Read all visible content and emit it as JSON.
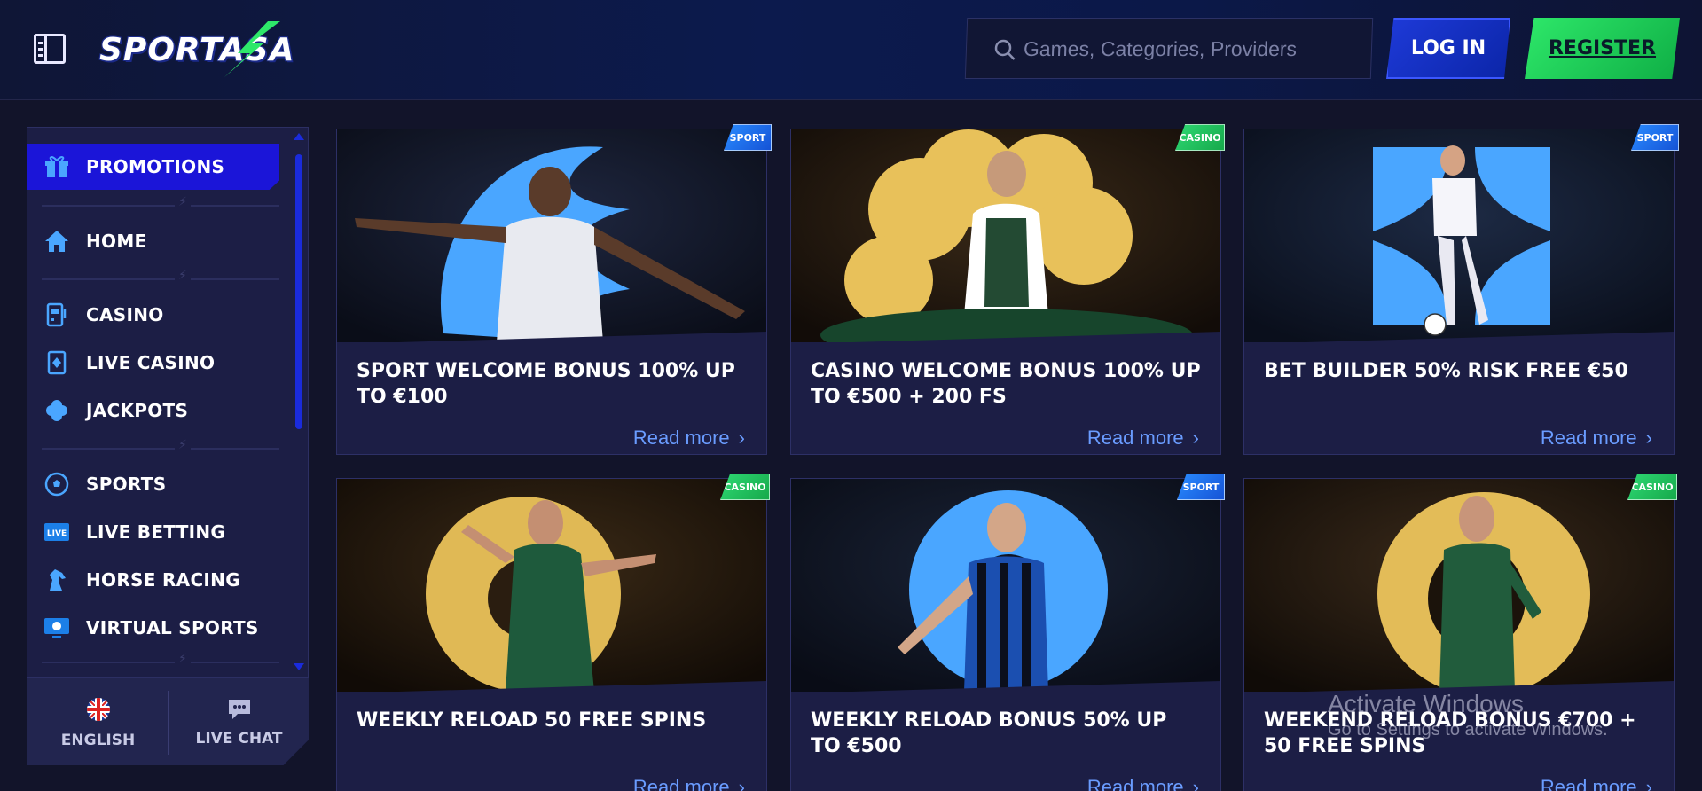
{
  "header": {
    "logo_text": "SPORTASA",
    "search_placeholder": "Games, Categories, Providers",
    "login_label": "LOG IN",
    "register_label": "REGISTER"
  },
  "sidebar": {
    "items": [
      {
        "label": "PROMOTIONS",
        "icon": "gift-icon",
        "active": true
      },
      {
        "label": "HOME",
        "icon": "home-icon"
      },
      {
        "label": "CASINO",
        "icon": "slot-machine-icon"
      },
      {
        "label": "LIVE CASINO",
        "icon": "card-diamond-icon"
      },
      {
        "label": "JACKPOTS",
        "icon": "clover-icon"
      },
      {
        "label": "SPORTS",
        "icon": "soccer-ball-icon"
      },
      {
        "label": "LIVE BETTING",
        "icon": "live-icon"
      },
      {
        "label": "HORSE RACING",
        "icon": "horse-icon"
      },
      {
        "label": "VIRTUAL SPORTS",
        "icon": "monitor-icon"
      }
    ],
    "language_label": "ENGLISH",
    "live_chat_label": "LIVE CHAT"
  },
  "promotions": [
    {
      "title": "SPORT WELCOME BONUS 100% UP TO €100",
      "badge": "SPORT",
      "read_more": "Read more"
    },
    {
      "title": "CASINO WELCOME BONUS 100% UP TO €500 + 200 FS",
      "badge": "CASINO",
      "read_more": "Read more"
    },
    {
      "title": "BET BUILDER 50% RISK FREE €50",
      "badge": "SPORT",
      "read_more": "Read more"
    },
    {
      "title": "WEEKLY RELOAD 50 FREE SPINS",
      "badge": "CASINO",
      "read_more": "Read more"
    },
    {
      "title": "WEEKLY RELOAD BONUS 50% UP TO €500",
      "badge": "SPORT",
      "read_more": "Read more"
    },
    {
      "title": "WEEKEND RELOAD BONUS €700 + 50 FREE SPINS",
      "badge": "CASINO",
      "read_more": "Read more"
    }
  ],
  "watermark": {
    "title": "Activate Windows",
    "subtitle": "Go to Settings to activate Windows."
  },
  "colors": {
    "accent_blue": "#1b15d8",
    "register_green": "#2ee86a",
    "link_blue": "#6a9cff",
    "sport_badge": "#1f6cf0",
    "casino_badge": "#22c35e"
  }
}
